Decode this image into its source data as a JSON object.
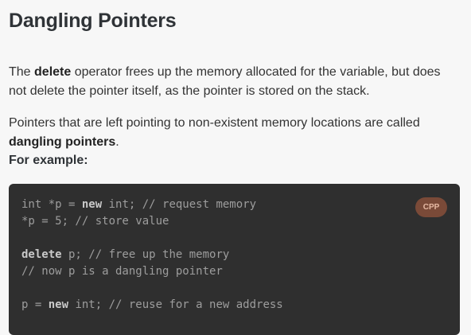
{
  "page": {
    "title": "Dangling Pointers"
  },
  "paragraph1": {
    "before": "The ",
    "bold": "delete",
    "after": " operator frees up the memory allocated for the variable, but does not delete the pointer itself, as the pointer is stored on the stack."
  },
  "paragraph2": {
    "before": "Pointers that are left pointing to non-existent memory locations are called ",
    "bold": "dangling pointers",
    "after": "."
  },
  "example_label": "For example:",
  "code": {
    "language": "CPP",
    "lines": {
      "l1a": "int *p = ",
      "l1kw": "new",
      "l1b": " int; // request memory",
      "l2": "*p = 5; // store value",
      "l3": "",
      "l4kw": "delete",
      "l4b": " p; // free up the memory",
      "l5": "// now p is a dangling pointer",
      "l6": "",
      "l7a": "p = ",
      "l7kw": "new",
      "l7b": " int; // reuse for a new address"
    }
  }
}
